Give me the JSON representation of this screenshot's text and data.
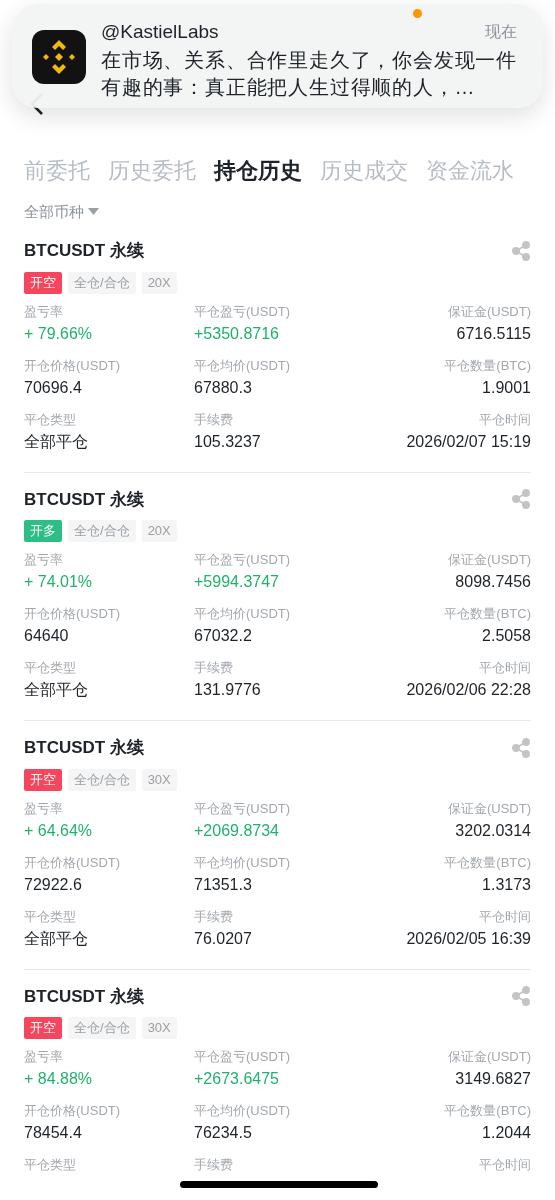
{
  "notification": {
    "sender": "@KastielLabs",
    "time": "现在",
    "message": "在市场、关系、合作里走久了，你会发现一件有趣的事：真正能把人生过得顺的人，…",
    "unread": true
  },
  "tabs": [
    {
      "label": "前委托",
      "selected": false
    },
    {
      "label": "历史委托",
      "selected": false
    },
    {
      "label": "持仓历史",
      "selected": true
    },
    {
      "label": "历史成交",
      "selected": false
    },
    {
      "label": "资金流水",
      "selected": false
    }
  ],
  "filter": {
    "label": "全部币种"
  },
  "positions": [
    {
      "symbol": "BTCUSDT 永续",
      "side": {
        "label": "开空",
        "kind": "short"
      },
      "margin_mode": "全仓/合仓",
      "leverage": "20X",
      "fields": [
        {
          "label": "盈亏率",
          "value": "+ 79.66%",
          "kind": "gain"
        },
        {
          "label": "平仓盈亏(USDT)",
          "value": "+5350.8716",
          "kind": "gain"
        },
        {
          "label": "保证金(USDT)",
          "value": "6716.5115",
          "kind": "plain"
        },
        {
          "label": "开仓价格(USDT)",
          "value": "70696.4",
          "kind": "plain"
        },
        {
          "label": "平仓均价(USDT)",
          "value": "67880.3",
          "kind": "plain"
        },
        {
          "label": "平仓数量(BTC)",
          "value": "1.9001",
          "kind": "plain"
        },
        {
          "label": "平仓类型",
          "value": "全部平仓",
          "kind": "plain"
        },
        {
          "label": "手续费",
          "value": "105.3237",
          "kind": "plain"
        },
        {
          "label": "平仓时间",
          "value": "2026/02/07 15:19",
          "kind": "plain"
        }
      ]
    },
    {
      "symbol": "BTCUSDT 永续",
      "side": {
        "label": "开多",
        "kind": "long"
      },
      "margin_mode": "全仓/合仓",
      "leverage": "20X",
      "fields": [
        {
          "label": "盈亏率",
          "value": "+ 74.01%",
          "kind": "gain"
        },
        {
          "label": "平仓盈亏(USDT)",
          "value": "+5994.3747",
          "kind": "gain"
        },
        {
          "label": "保证金(USDT)",
          "value": "8098.7456",
          "kind": "plain"
        },
        {
          "label": "开仓价格(USDT)",
          "value": "64640",
          "kind": "plain"
        },
        {
          "label": "平仓均价(USDT)",
          "value": "67032.2",
          "kind": "plain"
        },
        {
          "label": "平仓数量(BTC)",
          "value": "2.5058",
          "kind": "plain"
        },
        {
          "label": "平仓类型",
          "value": "全部平仓",
          "kind": "plain"
        },
        {
          "label": "手续费",
          "value": "131.9776",
          "kind": "plain"
        },
        {
          "label": "平仓时间",
          "value": "2026/02/06 22:28",
          "kind": "plain"
        }
      ]
    },
    {
      "symbol": "BTCUSDT 永续",
      "side": {
        "label": "开空",
        "kind": "short"
      },
      "margin_mode": "全仓/合仓",
      "leverage": "30X",
      "fields": [
        {
          "label": "盈亏率",
          "value": "+ 64.64%",
          "kind": "gain"
        },
        {
          "label": "平仓盈亏(USDT)",
          "value": "+2069.8734",
          "kind": "gain"
        },
        {
          "label": "保证金(USDT)",
          "value": "3202.0314",
          "kind": "plain"
        },
        {
          "label": "开仓价格(USDT)",
          "value": "72922.6",
          "kind": "plain"
        },
        {
          "label": "平仓均价(USDT)",
          "value": "71351.3",
          "kind": "plain"
        },
        {
          "label": "平仓数量(BTC)",
          "value": "1.3173",
          "kind": "plain"
        },
        {
          "label": "平仓类型",
          "value": "全部平仓",
          "kind": "plain"
        },
        {
          "label": "手续费",
          "value": "76.0207",
          "kind": "plain"
        },
        {
          "label": "平仓时间",
          "value": "2026/02/05 16:39",
          "kind": "plain"
        }
      ]
    },
    {
      "symbol": "BTCUSDT 永续",
      "side": {
        "label": "开空",
        "kind": "short"
      },
      "margin_mode": "全仓/合仓",
      "leverage": "30X",
      "fields": [
        {
          "label": "盈亏率",
          "value": "+ 84.88%",
          "kind": "gain"
        },
        {
          "label": "平仓盈亏(USDT)",
          "value": "+2673.6475",
          "kind": "gain"
        },
        {
          "label": "保证金(USDT)",
          "value": "3149.6827",
          "kind": "plain"
        },
        {
          "label": "开仓价格(USDT)",
          "value": "78454.4",
          "kind": "plain"
        },
        {
          "label": "平仓均价(USDT)",
          "value": "76234.5",
          "kind": "plain"
        },
        {
          "label": "平仓数量(BTC)",
          "value": "1.2044",
          "kind": "plain"
        },
        {
          "label": "平仓类型"
        },
        {
          "label": "手续费"
        },
        {
          "label": "平仓时间"
        }
      ]
    }
  ]
}
